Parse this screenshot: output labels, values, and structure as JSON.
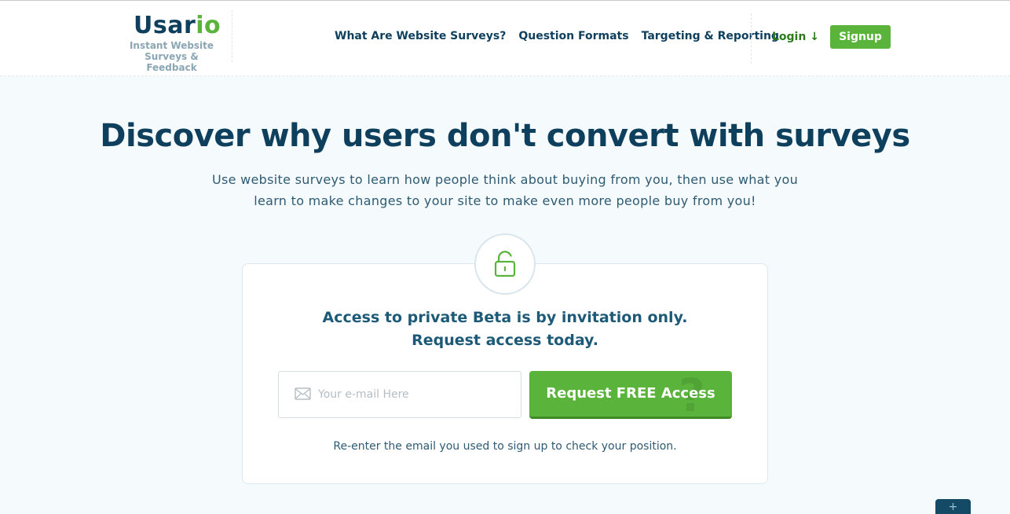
{
  "header": {
    "logo": {
      "prefix": "Usar",
      "accent": "io",
      "tagline_line1": "Instant Website",
      "tagline_line2": "Surveys & Feedback"
    },
    "nav": [
      {
        "label": "What Are Website Surveys?"
      },
      {
        "label": "Question Formats"
      },
      {
        "label": "Targeting & Reporting"
      }
    ],
    "login_label": "Login ↓",
    "signup_label": "Signup"
  },
  "hero": {
    "title": "Discover why users don't convert with surveys",
    "subtitle_line1": "Use website surveys to learn how people think about buying from you, then use what you",
    "subtitle_line2": "learn to make changes to your site to make even more people buy from you!"
  },
  "card": {
    "icon": "unlock-icon",
    "title_line1": "Access to private Beta is by invitation only.",
    "title_line2": "Request access today.",
    "email_placeholder": "Your e-mail Here",
    "email_value": "",
    "cta_label": "Request FREE Access",
    "cta_watermark": "?",
    "helper_text": "Re-enter the email you used to sign up to check your position."
  },
  "feedback_tab": {
    "label": "+"
  },
  "colors": {
    "brand_dark": "#0e3f5c",
    "brand_green": "#5ab43c",
    "background": "#f5fafd"
  }
}
